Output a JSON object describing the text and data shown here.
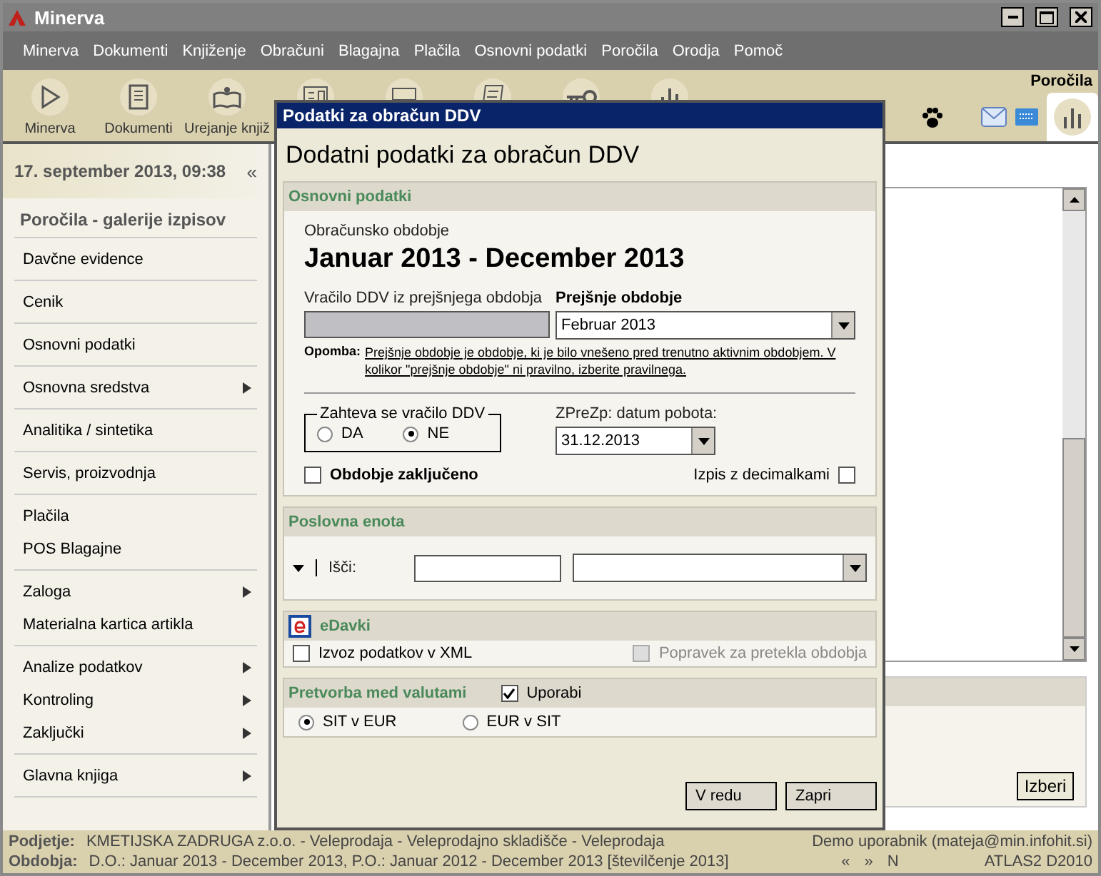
{
  "window": {
    "title": "Minerva"
  },
  "menu": [
    "Minerva",
    "Dokumenti",
    "Knjiženje",
    "Obračuni",
    "Blagajna",
    "Plačila",
    "Osnovni podatki",
    "Poročila",
    "Orodja",
    "Pomoč"
  ],
  "toolbar": {
    "section_title": "Poročila",
    "buttons": [
      "Minerva",
      "Dokumenti",
      "Urejanje knjiž"
    ]
  },
  "sidebar": {
    "date": "17. september 2013, 09:38",
    "collapse": "«",
    "title": "Poročila - galerije izpisov",
    "groups": [
      [
        {
          "label": "Davčne evidence",
          "has_submenu": false
        }
      ],
      [
        {
          "label": "Cenik",
          "has_submenu": false
        }
      ],
      [
        {
          "label": "Osnovni podatki",
          "has_submenu": false
        }
      ],
      [
        {
          "label": "Osnovna sredstva",
          "has_submenu": true
        }
      ],
      [
        {
          "label": "Analitika / sintetika",
          "has_submenu": false
        }
      ],
      [
        {
          "label": "Servis, proizvodnja",
          "has_submenu": false
        }
      ],
      [
        {
          "label": "Plačila",
          "has_submenu": false
        },
        {
          "label": "POS Blagajne",
          "has_submenu": false
        }
      ],
      [
        {
          "label": "Zaloga",
          "has_submenu": true
        },
        {
          "label": "Materialna kartica artikla",
          "has_submenu": false
        }
      ],
      [
        {
          "label": "Analize podatkov",
          "has_submenu": true
        },
        {
          "label": "Kontroling",
          "has_submenu": true
        },
        {
          "label": "Zaključki",
          "has_submenu": true
        }
      ],
      [
        {
          "label": "Glavna knjiga",
          "has_submenu": true
        }
      ]
    ]
  },
  "main": {
    "select_button": "Izberi"
  },
  "dialog": {
    "title": "Podatki za obračun DDV",
    "heading": "Dodatni podatki za obračun DDV",
    "basic": {
      "header": "Osnovni podatki",
      "period_label": "Obračunsko obdobje",
      "period": "Januar 2013 - December 2013",
      "refund_label": "Vračilo DDV iz prejšnjega obdobja",
      "previous_label": "Prejšnje obdobje",
      "previous_value": "Februar 2013",
      "note_label": "Opomba:",
      "note": "Prejšnje obdobje je obdobje, ki je bilo vnešeno pred trenutno aktivnim obdobjem. V kolikor \"prejšnje obdobje\" ni pravilno, izberite pravilnega.",
      "refund_group": "Zahteva se vračilo DDV",
      "refund_options": [
        {
          "label": "DA",
          "selected": false
        },
        {
          "label": "NE",
          "selected": true
        }
      ],
      "offset_label": "ZPreZp: datum pobota:",
      "offset_value": "31.12.2013",
      "closed": {
        "label": "Obdobje zaključeno",
        "checked": false
      },
      "decimals": {
        "label": "Izpis z decimalkami",
        "checked": false
      }
    },
    "unit": {
      "header": "Poslovna enota",
      "search_label": "Išči:"
    },
    "edavki": {
      "header": "eDavki",
      "export": {
        "label": "Izvoz podatkov v XML",
        "checked": false,
        "disabled": false
      },
      "correction": {
        "label": "Popravek za pretekla obdobja",
        "checked": false,
        "disabled": true
      }
    },
    "currency": {
      "header": "Pretvorba med valutami",
      "use": {
        "label": "Uporabi",
        "checked": true
      },
      "options": [
        {
          "label": "SIT v EUR",
          "selected": true
        },
        {
          "label": "EUR v SIT",
          "selected": false
        }
      ]
    },
    "buttons": [
      "V redu",
      "Zapri"
    ]
  },
  "status_bar": {
    "company_label": "Podjetje:",
    "company": "KMETIJSKA ZADRUGA z.o.o. - Veleprodaja - Veleprodajno skladišče - Veleprodaja",
    "user": "Demo uporabnik (mateja@min.infohit.si)",
    "periods_label": "Obdobja:",
    "periods": "D.O.: Januar 2013 - December 2013, P.O.: Januar 2012 - December 2013 [številčenje 2013]",
    "prev": "«",
    "next": "»",
    "mode": "N",
    "version": "ATLAS2 D2010"
  }
}
